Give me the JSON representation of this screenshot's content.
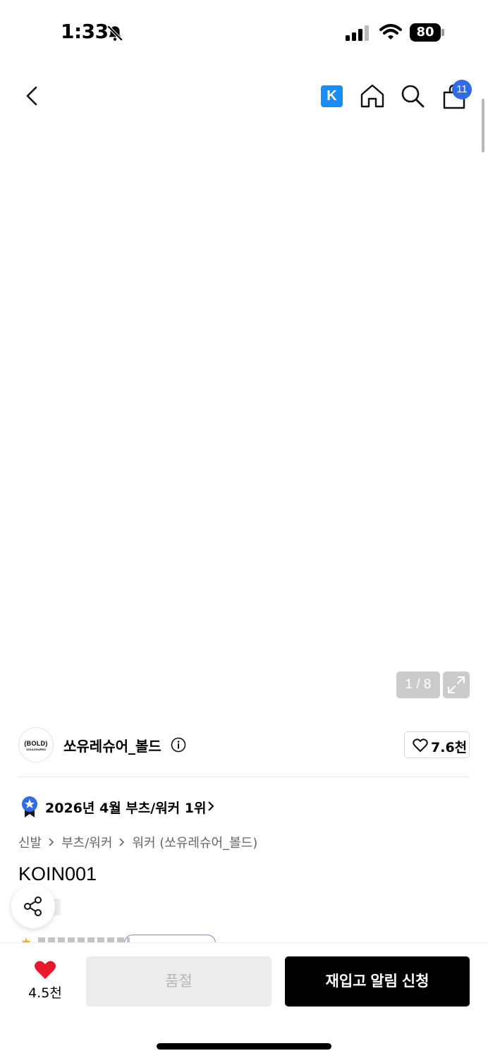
{
  "status_bar": {
    "time": "1:33",
    "battery": "80"
  },
  "nav": {
    "cart_count": "11",
    "k_label": "K"
  },
  "gallery": {
    "pager": "1 / 8"
  },
  "brand": {
    "logo_line1": "(BOLD)",
    "logo_line2": "SOULESURES",
    "name": "쏘유레슈어_볼드",
    "likes": "7.6천"
  },
  "ranking": {
    "text": "2026년 4월 부츠/워커 1위"
  },
  "breadcrumb": {
    "items": [
      "신발",
      "부츠/워커",
      "워커 (쏘유레슈어_볼드)"
    ]
  },
  "product": {
    "title": "KOIN001"
  },
  "bottom": {
    "like_count": "4.5천",
    "soldout_label": "품절",
    "restock_label": "재입고 알림 신청"
  },
  "colors": {
    "accent_blue": "#2f6ce5",
    "k_blue": "#1b8cf3",
    "heart_red": "#e8192c",
    "primary_black": "#000000"
  }
}
